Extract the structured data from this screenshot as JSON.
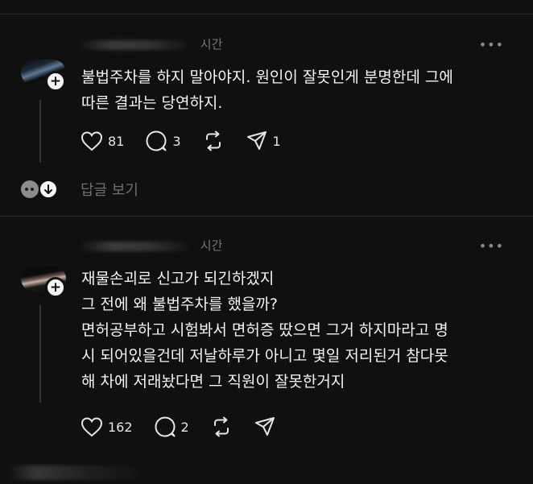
{
  "posts": [
    {
      "meta_time": "시간",
      "more_label": "•••",
      "lines": [
        "불법주차를 하지 말아야지. 원인이 잘못인게 분명한데 그에",
        "따른 결과는 당연하지."
      ],
      "likes": "81",
      "comments": "3",
      "shares": "1",
      "icons": [
        "heart-icon",
        "comment-icon",
        "repost-icon",
        "share-icon"
      ]
    },
    {
      "meta_time": "시간",
      "more_label": "•••",
      "lines": [
        "재물손괴로 신고가 되긴하겠지",
        "그 전에 왜 불법주차를 했을까?",
        "면허공부하고 시험봐서 면허증 땄으면 그거 하지마라고 명",
        "시 되어있을건데 저날하루가 아니고 몇일 저리된거 참다못",
        "해 차에 저래놨다면 그 직원이 잘못한거지"
      ],
      "likes": "162",
      "comments": "2",
      "icons": [
        "heart-icon",
        "comment-icon",
        "repost-icon",
        "share-icon"
      ]
    }
  ],
  "replies": {
    "label": "답글 보기"
  },
  "colors": {
    "background": "#101010",
    "text": "#f3f5f7",
    "muted": "#777777",
    "divider": "#2a2a2a"
  }
}
